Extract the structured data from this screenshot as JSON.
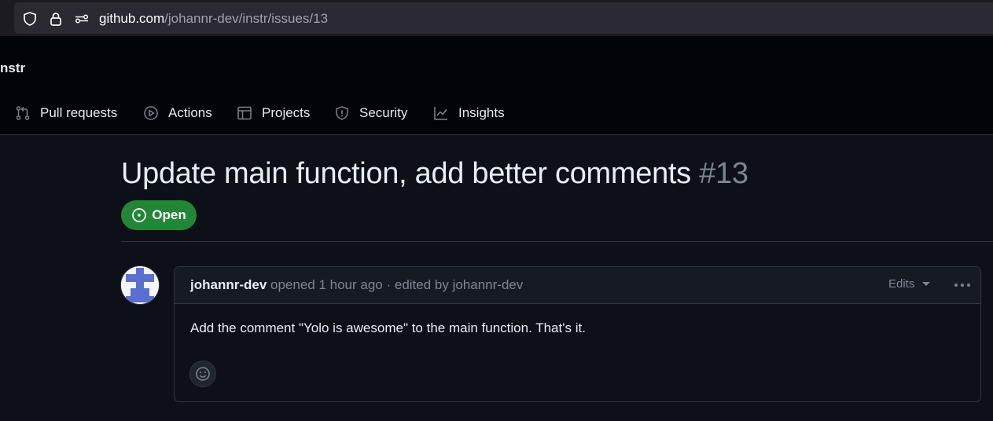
{
  "browser": {
    "url_domain": "github.com",
    "url_path": "/johannr-dev/instr/issues/13"
  },
  "repo": {
    "name": "nstr"
  },
  "nav": {
    "items": [
      {
        "label": "Pull requests",
        "icon": "pull-request-icon"
      },
      {
        "label": "Actions",
        "icon": "play-icon"
      },
      {
        "label": "Projects",
        "icon": "table-icon"
      },
      {
        "label": "Security",
        "icon": "shield-icon"
      },
      {
        "label": "Insights",
        "icon": "graph-icon"
      }
    ]
  },
  "issue": {
    "title": "Update main function, add better comments",
    "number": "#13",
    "state": "Open",
    "state_color": "#238636"
  },
  "comment": {
    "author": "johannr-dev",
    "meta": " opened 1 hour ago · edited by johannr-dev",
    "edits_label": "Edits",
    "body": "Add the comment \"Yolo is awesome\" to the main function. That's it."
  }
}
